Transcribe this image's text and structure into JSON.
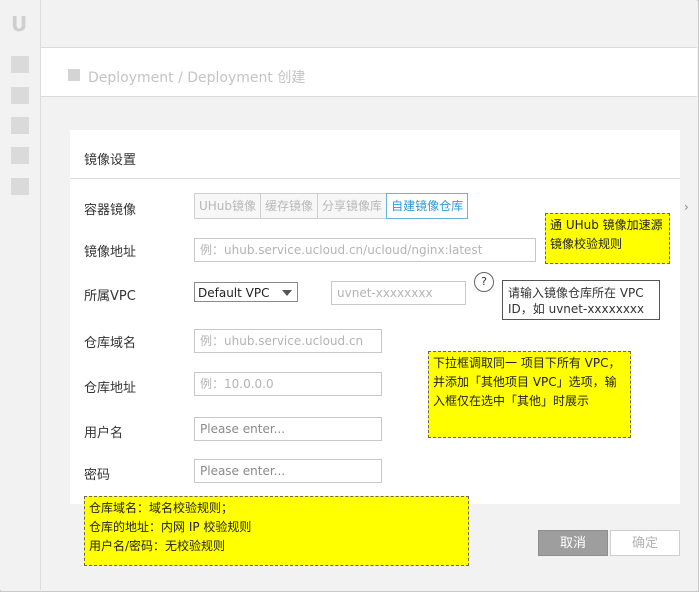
{
  "app": {
    "logo": "U"
  },
  "sidebar": {
    "items": [
      "nav-1",
      "nav-2",
      "nav-3",
      "nav-4",
      "nav-5"
    ]
  },
  "header": {
    "breadcrumb": "Deployment / Deployment 创建"
  },
  "card": {
    "title": "镜像设置"
  },
  "form": {
    "image_label": "容器镜像",
    "image_tabs": [
      "UHub镜像",
      "缓存镜像",
      "分享镜像库",
      "自建镜像仓库"
    ],
    "active_tab": 3,
    "image_addr_label": "镜像地址",
    "image_addr_placeholder": "例：uhub.service.ucloud.cn/ucloud/nginx:latest",
    "vpc_label": "所属VPC",
    "vpc_select": "Default VPC",
    "vpc_input_placeholder": "uvnet-xxxxxxxx",
    "vpc_help_icon": "?",
    "vpc_tip": "请输入镜像仓库所在 VPC ID，如 uvnet-xxxxxxxx",
    "domain_label": "仓库域名",
    "domain_placeholder": "例：uhub.service.ucloud.cn",
    "repo_addr_label": "仓库地址",
    "repo_addr_placeholder": "例：10.0.0.0",
    "username_label": "用户名",
    "username_placeholder": "Please enter...",
    "password_label": "密码",
    "password_placeholder": "Please enter..."
  },
  "notes": {
    "uhub": "通 UHub 镜像加速源镜像校验规则",
    "vpc": "下拉框调取同一 项目下所有 VPC，并添加「其他项目 VPC」选项，输入框仅在选中「其他」时展示",
    "rules": [
      "仓库域名：域名校验规则；",
      "仓库的地址：内网 IP 校验规则",
      "用户名/密码：无校验规则"
    ]
  },
  "chevron": "›",
  "actions": {
    "cancel": "取消",
    "confirm": "确定"
  }
}
